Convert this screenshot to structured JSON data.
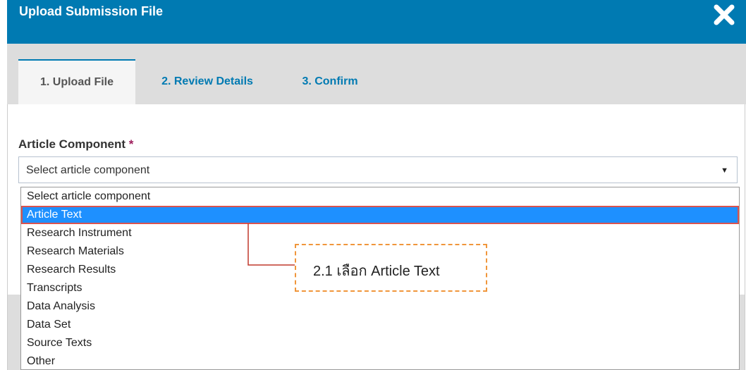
{
  "modal": {
    "title": "Upload Submission File",
    "close_icon": "close-icon"
  },
  "tabs": [
    {
      "label": "1. Upload File"
    },
    {
      "label": "2. Review Details"
    },
    {
      "label": "3. Confirm"
    }
  ],
  "field": {
    "label": "Article Component",
    "required_marker": "*",
    "selected_value": "Select article component"
  },
  "dropdown_options": [
    {
      "label": "Select article component"
    },
    {
      "label": "Article Text"
    },
    {
      "label": "Research Instrument"
    },
    {
      "label": "Research Materials"
    },
    {
      "label": "Research Results"
    },
    {
      "label": "Transcripts"
    },
    {
      "label": "Data Analysis"
    },
    {
      "label": "Data Set"
    },
    {
      "label": "Source Texts"
    },
    {
      "label": "Other"
    }
  ],
  "annotation": {
    "text": "2.1 เลือก Article Text"
  },
  "colors": {
    "header": "#007ab2",
    "highlight": "#1e90ff",
    "highlight_outline": "#d9534f",
    "callout_border": "#f0963b",
    "connector": "#c0392b"
  }
}
